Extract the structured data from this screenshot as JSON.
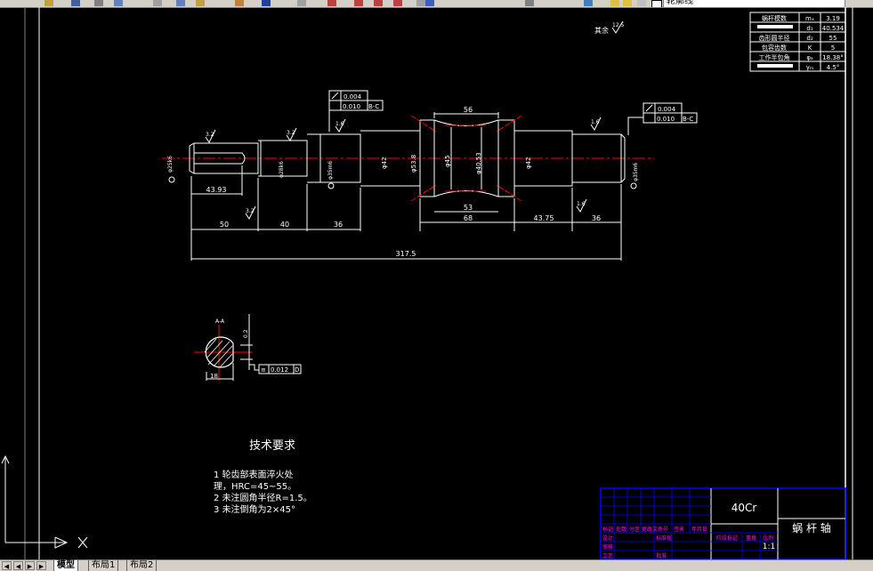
{
  "toolbar": {
    "layer_name": "轮廓线"
  },
  "params_table": [
    {
      "name": "蜗杆模数",
      "symbol": "mₓ",
      "value": "3.19"
    },
    {
      "name": "",
      "symbol": "d₁",
      "value": "40.534"
    },
    {
      "name": "齿形圆半径",
      "symbol": "d₂",
      "value": "55"
    },
    {
      "name": "包容齿数",
      "symbol": "K",
      "value": "5"
    },
    {
      "name": "工作半包角",
      "symbol": "φₐ",
      "value": "18.38°"
    },
    {
      "name": "",
      "symbol": "γₘ",
      "value": "4.5°"
    }
  ],
  "roughness_note": "其余",
  "roughness_note_value": "12.5",
  "gdt": {
    "left_top": "0.004",
    "left_bottom": "0.010",
    "left_datum": "B-C",
    "right_top": "0.004",
    "right_bottom": "0.010",
    "right_datum": "B-C",
    "section_symmetry": "0.012",
    "section_datum": "D"
  },
  "roughness": [
    "3.2",
    "3.2",
    "1.6",
    "1.6",
    "3.2",
    "1.6"
  ],
  "diameters": [
    "φ25k6",
    "φ28k6",
    "φ35m6",
    "φ42",
    "φ53.8",
    "φ45",
    "φ40.53",
    "φ42",
    "φ35m6",
    "φ35m6"
  ],
  "dimensions": {
    "d_43_93": "43.93",
    "d_50": "50",
    "d_40": "40",
    "d_36_left": "36",
    "d_56": "56",
    "d_53": "53",
    "d_68": "68",
    "d_43_75": "43.75",
    "d_36_right": "36",
    "d_317_5": "317.5",
    "d_section_keyway": "0.2",
    "d_section_width": "18"
  },
  "section": {
    "label": "A-A"
  },
  "tech_title": "技术要求",
  "tech_lines": [
    "1  轮齿部表面淬火处",
    "理，HRC=45~55。",
    "2  未注圆角半径R=1.5。",
    "3  未注倒角为2×45°"
  ],
  "title_block": {
    "material": "40Cr",
    "part_name": "蜗  杆  轴",
    "scale": "1:1",
    "small_labels": [
      "标记",
      "处数",
      "分区",
      "更改文件号",
      "签名",
      "年月日",
      "设计",
      "标准化",
      "阶段标记",
      "重量",
      "比例",
      "审核",
      "工艺",
      "批准"
    ]
  },
  "layout_tabs": [
    "模型",
    "布局1",
    "布局2"
  ],
  "colors": {
    "background": "#000000",
    "line": "#ffffff",
    "center": "#ff0000",
    "frame": "#0000ff",
    "label": "#ff00ff"
  }
}
